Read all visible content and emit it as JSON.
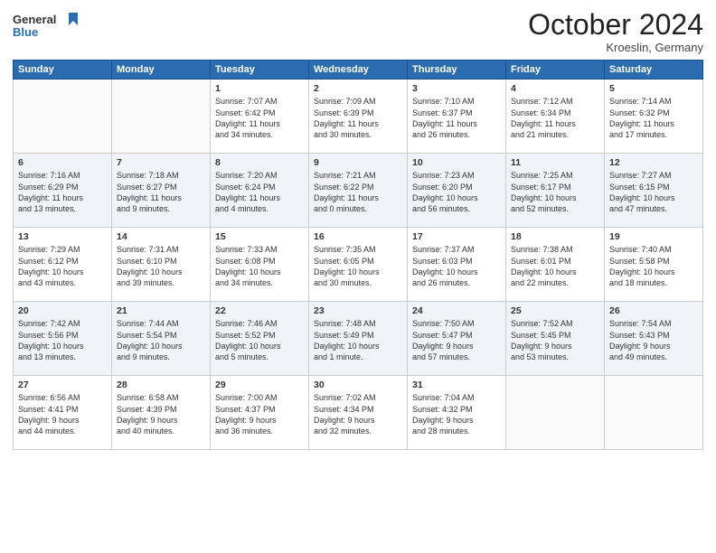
{
  "header": {
    "title": "October 2024",
    "location": "Kroeslin, Germany"
  },
  "columns": [
    "Sunday",
    "Monday",
    "Tuesday",
    "Wednesday",
    "Thursday",
    "Friday",
    "Saturday"
  ],
  "weeks": [
    [
      {
        "day": "",
        "content": ""
      },
      {
        "day": "",
        "content": ""
      },
      {
        "day": "1",
        "content": "Sunrise: 7:07 AM\nSunset: 6:42 PM\nDaylight: 11 hours\nand 34 minutes."
      },
      {
        "day": "2",
        "content": "Sunrise: 7:09 AM\nSunset: 6:39 PM\nDaylight: 11 hours\nand 30 minutes."
      },
      {
        "day": "3",
        "content": "Sunrise: 7:10 AM\nSunset: 6:37 PM\nDaylight: 11 hours\nand 26 minutes."
      },
      {
        "day": "4",
        "content": "Sunrise: 7:12 AM\nSunset: 6:34 PM\nDaylight: 11 hours\nand 21 minutes."
      },
      {
        "day": "5",
        "content": "Sunrise: 7:14 AM\nSunset: 6:32 PM\nDaylight: 11 hours\nand 17 minutes."
      }
    ],
    [
      {
        "day": "6",
        "content": "Sunrise: 7:16 AM\nSunset: 6:29 PM\nDaylight: 11 hours\nand 13 minutes."
      },
      {
        "day": "7",
        "content": "Sunrise: 7:18 AM\nSunset: 6:27 PM\nDaylight: 11 hours\nand 9 minutes."
      },
      {
        "day": "8",
        "content": "Sunrise: 7:20 AM\nSunset: 6:24 PM\nDaylight: 11 hours\nand 4 minutes."
      },
      {
        "day": "9",
        "content": "Sunrise: 7:21 AM\nSunset: 6:22 PM\nDaylight: 11 hours\nand 0 minutes."
      },
      {
        "day": "10",
        "content": "Sunrise: 7:23 AM\nSunset: 6:20 PM\nDaylight: 10 hours\nand 56 minutes."
      },
      {
        "day": "11",
        "content": "Sunrise: 7:25 AM\nSunset: 6:17 PM\nDaylight: 10 hours\nand 52 minutes."
      },
      {
        "day": "12",
        "content": "Sunrise: 7:27 AM\nSunset: 6:15 PM\nDaylight: 10 hours\nand 47 minutes."
      }
    ],
    [
      {
        "day": "13",
        "content": "Sunrise: 7:29 AM\nSunset: 6:12 PM\nDaylight: 10 hours\nand 43 minutes."
      },
      {
        "day": "14",
        "content": "Sunrise: 7:31 AM\nSunset: 6:10 PM\nDaylight: 10 hours\nand 39 minutes."
      },
      {
        "day": "15",
        "content": "Sunrise: 7:33 AM\nSunset: 6:08 PM\nDaylight: 10 hours\nand 34 minutes."
      },
      {
        "day": "16",
        "content": "Sunrise: 7:35 AM\nSunset: 6:05 PM\nDaylight: 10 hours\nand 30 minutes."
      },
      {
        "day": "17",
        "content": "Sunrise: 7:37 AM\nSunset: 6:03 PM\nDaylight: 10 hours\nand 26 minutes."
      },
      {
        "day": "18",
        "content": "Sunrise: 7:38 AM\nSunset: 6:01 PM\nDaylight: 10 hours\nand 22 minutes."
      },
      {
        "day": "19",
        "content": "Sunrise: 7:40 AM\nSunset: 5:58 PM\nDaylight: 10 hours\nand 18 minutes."
      }
    ],
    [
      {
        "day": "20",
        "content": "Sunrise: 7:42 AM\nSunset: 5:56 PM\nDaylight: 10 hours\nand 13 minutes."
      },
      {
        "day": "21",
        "content": "Sunrise: 7:44 AM\nSunset: 5:54 PM\nDaylight: 10 hours\nand 9 minutes."
      },
      {
        "day": "22",
        "content": "Sunrise: 7:46 AM\nSunset: 5:52 PM\nDaylight: 10 hours\nand 5 minutes."
      },
      {
        "day": "23",
        "content": "Sunrise: 7:48 AM\nSunset: 5:49 PM\nDaylight: 10 hours\nand 1 minute."
      },
      {
        "day": "24",
        "content": "Sunrise: 7:50 AM\nSunset: 5:47 PM\nDaylight: 9 hours\nand 57 minutes."
      },
      {
        "day": "25",
        "content": "Sunrise: 7:52 AM\nSunset: 5:45 PM\nDaylight: 9 hours\nand 53 minutes."
      },
      {
        "day": "26",
        "content": "Sunrise: 7:54 AM\nSunset: 5:43 PM\nDaylight: 9 hours\nand 49 minutes."
      }
    ],
    [
      {
        "day": "27",
        "content": "Sunrise: 6:56 AM\nSunset: 4:41 PM\nDaylight: 9 hours\nand 44 minutes."
      },
      {
        "day": "28",
        "content": "Sunrise: 6:58 AM\nSunset: 4:39 PM\nDaylight: 9 hours\nand 40 minutes."
      },
      {
        "day": "29",
        "content": "Sunrise: 7:00 AM\nSunset: 4:37 PM\nDaylight: 9 hours\nand 36 minutes."
      },
      {
        "day": "30",
        "content": "Sunrise: 7:02 AM\nSunset: 4:34 PM\nDaylight: 9 hours\nand 32 minutes."
      },
      {
        "day": "31",
        "content": "Sunrise: 7:04 AM\nSunset: 4:32 PM\nDaylight: 9 hours\nand 28 minutes."
      },
      {
        "day": "",
        "content": ""
      },
      {
        "day": "",
        "content": ""
      }
    ]
  ]
}
